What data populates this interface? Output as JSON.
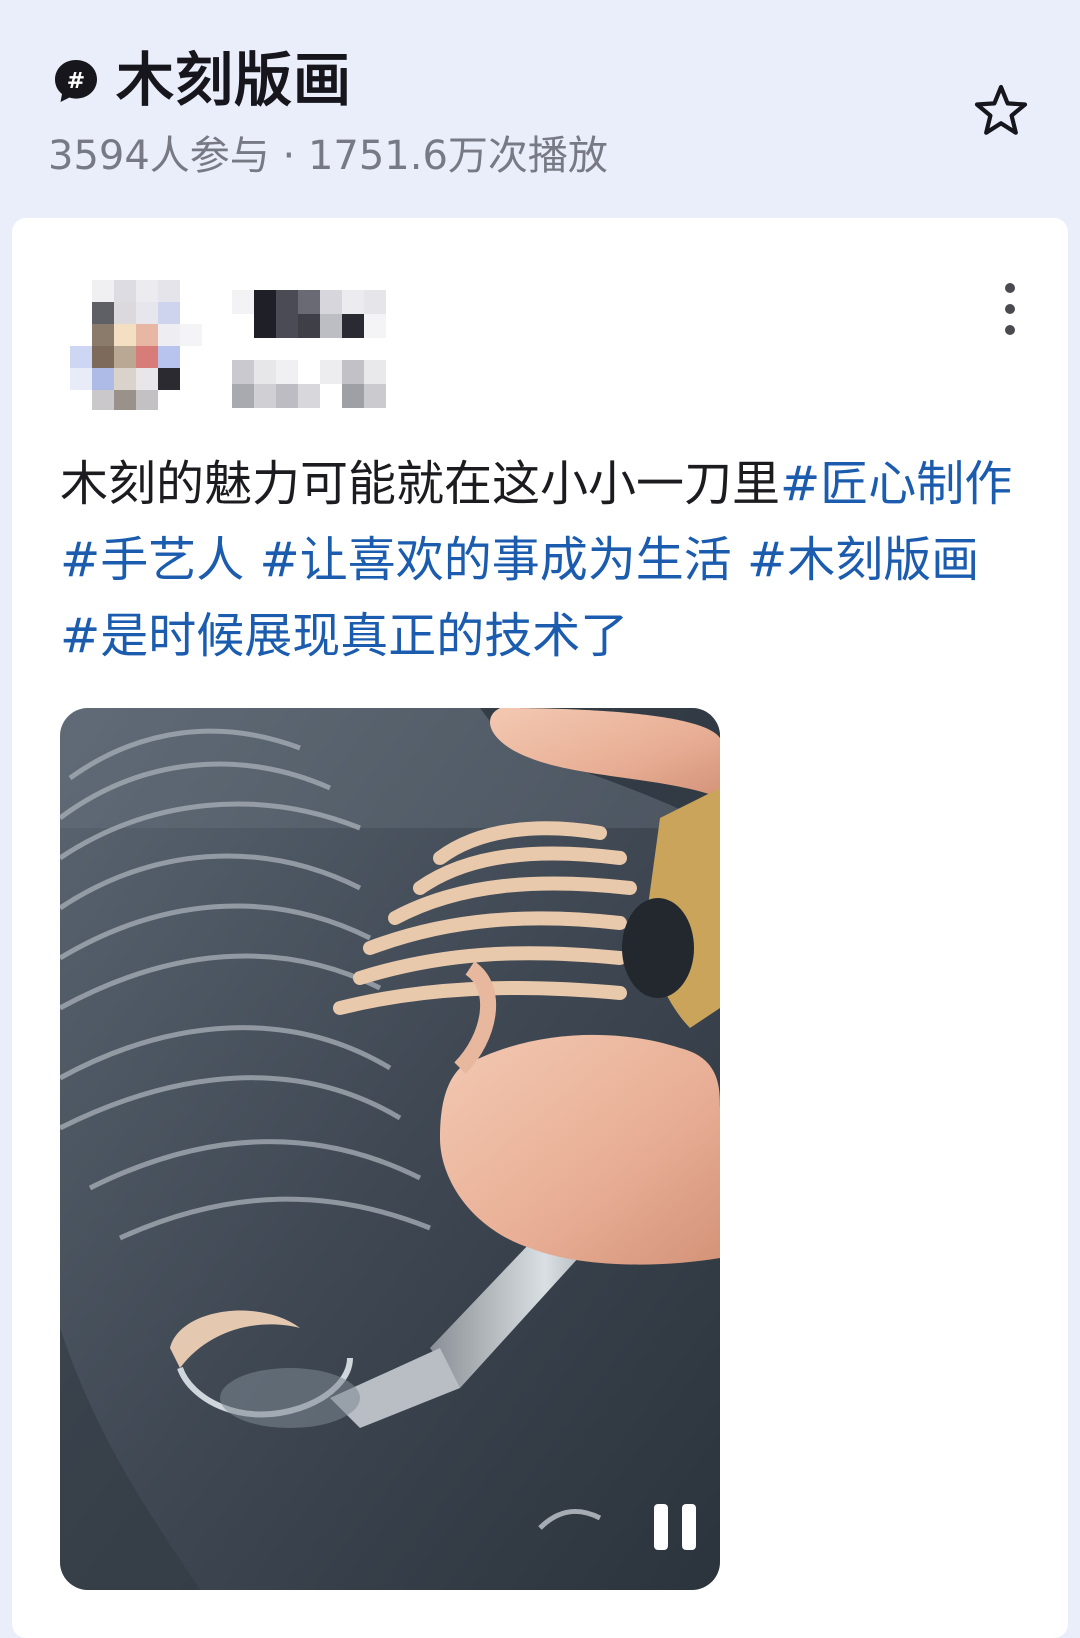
{
  "topic": {
    "icon": "hashtag-bubble-icon",
    "title": "木刻版画",
    "stats": "3594人参与 · 1751.6万次播放",
    "favorite_icon": "star-outline-icon"
  },
  "post": {
    "more_icon": "more-vertical-icon",
    "text": "木刻的魅力可能就在这小小一刀里",
    "hashtags": [
      "#匠心制作",
      "#手艺人",
      "#让喜欢的事成为生活",
      "#木刻版画",
      "#是时候展现真正的技术了"
    ],
    "video": {
      "playback_icon": "pause-icon"
    }
  },
  "colors": {
    "page_background": "#eaeefa",
    "card_background": "#ffffff",
    "hashtag": "#1b5caf",
    "stats_text": "#777a84"
  }
}
